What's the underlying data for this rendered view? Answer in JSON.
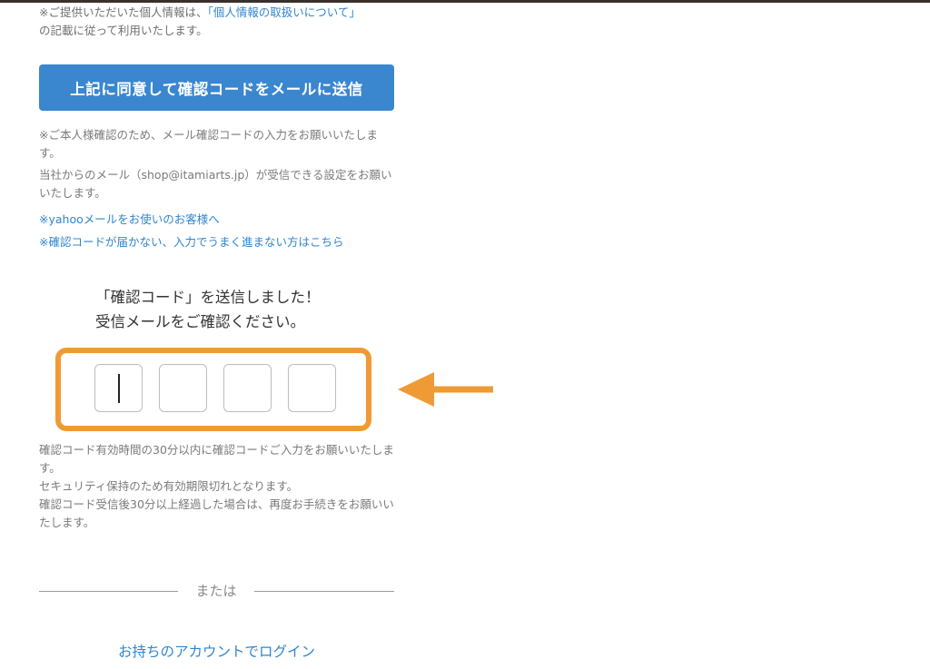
{
  "privacy": {
    "prefix": "※ご提供いただいた個人情報は、",
    "link": "「個人情報の取扱いについて」",
    "suffix": "の記載に従って利用いたします。"
  },
  "send_button_label": "上記に同意して確認コードをメールに送信",
  "notes": {
    "identity": "※ご本人様確認のため、メール確認コードの入力をお願いいたします。",
    "mail_setting": "当社からのメール（shop@itamiarts.jp）が受信できる設定をお願いいたします。"
  },
  "links": {
    "yahoo": "※yahooメールをお使いのお客様へ",
    "trouble": "※確認コードが届かない、入力でうまく進まない方はこちら"
  },
  "sent_message": {
    "line1": "「確認コード」を送信しました！",
    "line2": "受信メールをご確認ください。"
  },
  "code_inputs": [
    "",
    "",
    "",
    ""
  ],
  "expiry": {
    "line1": "確認コード有効時間の30分以内に確認コードご入力をお願いいたします。",
    "line2": "セキュリティ保持のため有効期限切れとなります。",
    "line3": "確認コード受信後30分以上経過した場合は、再度お手続きをお願いいたします。"
  },
  "or_label": "または",
  "login_link": "お持ちのアカウントでログイン",
  "colors": {
    "accent_blue": "#3a86cf",
    "link_blue": "#2f86cf",
    "highlight_orange": "#ef9a35"
  }
}
